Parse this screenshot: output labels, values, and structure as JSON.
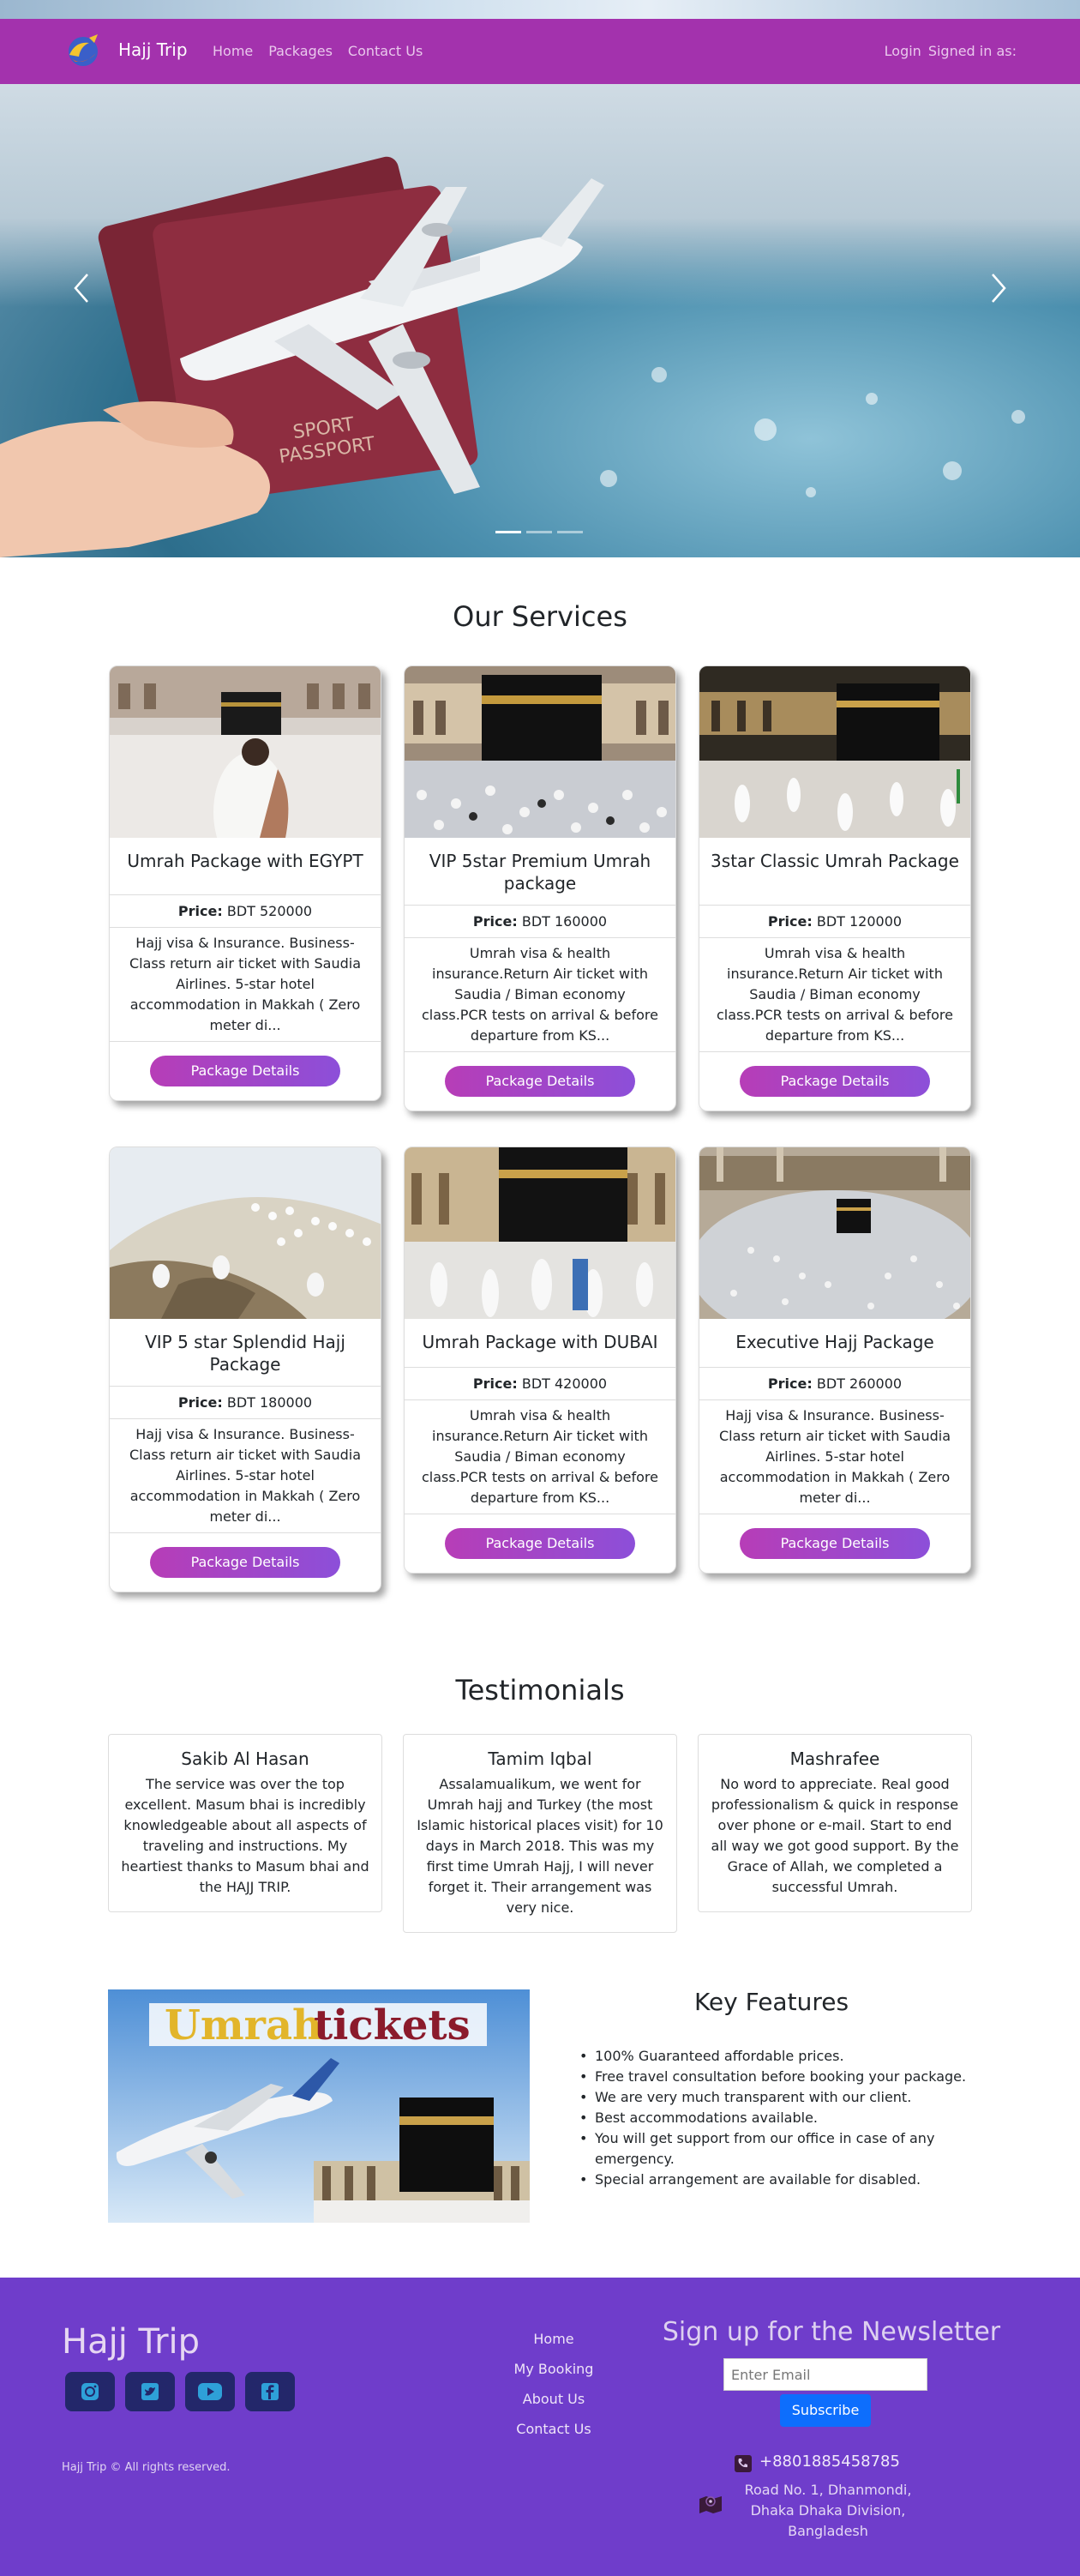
{
  "nav": {
    "brand": "Hajj Trip",
    "links": [
      "Home",
      "Packages",
      "Contact Us"
    ],
    "login": "Login",
    "signed_in": "Signed in as:"
  },
  "hero": {
    "prev_icon": "chevron-left-icon",
    "next_icon": "chevron-right-icon",
    "slides": 3,
    "active_slide": 1
  },
  "services": {
    "title": "Our Services",
    "price_label": "Price:",
    "button_label": "Package Details",
    "packages": [
      {
        "title": "Umrah Package with EGYPT",
        "price": "BDT 520000",
        "desc": "Hajj visa & Insurance. Business-Class return air ticket with Saudia Airlines. 5-star hotel accommodation in Makkah ( Zero meter di..."
      },
      {
        "title": "VIP 5star Premium Umrah package",
        "price": "BDT 160000",
        "desc": "Umrah visa & health insurance.Return Air ticket with Saudia / Biman economy class.PCR tests on arrival & before departure from KS..."
      },
      {
        "title": "3star Classic Umrah Package",
        "price": "BDT 120000",
        "desc": "Umrah visa & health insurance.Return Air ticket with Saudia / Biman economy class.PCR tests on arrival & before departure from KS..."
      },
      {
        "title": "VIP 5 star Splendid Hajj Package",
        "price": "BDT 180000",
        "desc": "Hajj visa & Insurance. Business-Class return air ticket with Saudia Airlines. 5-star hotel accommodation in Makkah ( Zero meter di..."
      },
      {
        "title": "Umrah Package with DUBAI",
        "price": "BDT 420000",
        "desc": "Umrah visa & health insurance.Return Air ticket with Saudia / Biman economy class.PCR tests on arrival & before departure from KS..."
      },
      {
        "title": "Executive Hajj Package",
        "price": "BDT 260000",
        "desc": "Hajj visa & Insurance. Business-Class return air ticket with Saudia Airlines. 5-star hotel accommodation in Makkah ( Zero meter di..."
      }
    ]
  },
  "testimonials": {
    "title": "Testimonials",
    "items": [
      {
        "name": "Sakib Al Hasan",
        "text": "The service was over the top excellent. Masum bhai is incredibly knowledgeable about all aspects of traveling and instructions. My heartiest thanks to Masum bhai and the HAJJ TRIP."
      },
      {
        "name": "Tamim Iqbal",
        "text": "Assalamualikum, we went for Umrah hajj and Turkey (the most Islamic historical places visit) for 10 days in March 2018. This was my first time Umrah Hajj, I will never forget it. Their arrangement was very nice."
      },
      {
        "name": "Mashrafee",
        "text": "No word to appreciate. Real good professionalism & quick in response over phone or e-mail. Start to end all way we got good support. By the Grace of Allah, we completed a successful Umrah."
      }
    ]
  },
  "features": {
    "image_text_1": "Umrah",
    "image_text_2": "tickets",
    "title": "Key Features",
    "items": [
      "100% Guaranteed affordable prices.",
      "Free travel consultation before booking your package.",
      "We are very much transparent with our client.",
      "Best accommodations available.",
      "You will get support from our office in case of any emergency.",
      "Special arrangement are available for disabled."
    ]
  },
  "footer": {
    "brand": "Hajj Trip",
    "socials": [
      "instagram-icon",
      "twitter-icon",
      "youtube-icon",
      "facebook-icon"
    ],
    "copyright": "Hajj Trip © All rights reserved.",
    "links": [
      "Home",
      "My Booking",
      "About Us",
      "Contact Us"
    ],
    "newsletter_title": "Sign up for the Newsletter",
    "email_placeholder": "Enter Email",
    "subscribe": "Subscribe",
    "phone": "+8801885458785",
    "address": "Road No. 1, Dhanmondi, Dhaka Dhaka Division, Bangladesh"
  },
  "colors": {
    "navbar": "#a332ad",
    "footer": "#6f3dcb",
    "button_gradient_start": "#b73db7",
    "button_gradient_end": "#8c4fd9",
    "subscribe": "#0d6efd"
  }
}
